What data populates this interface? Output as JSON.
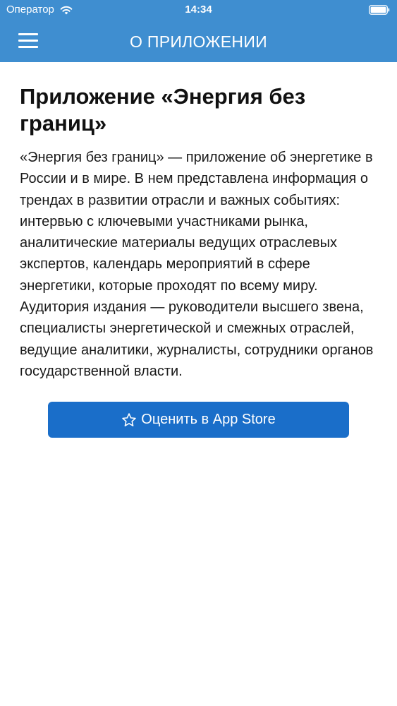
{
  "status_bar": {
    "carrier": "Оператор",
    "time": "14:34"
  },
  "nav": {
    "title": "О ПРИЛОЖЕНИИ"
  },
  "content": {
    "title": "Приложение «Энергия без границ»",
    "description": "«Энергия без границ» — приложение об энергетике в России и в мире. В нем представлена информация о трендах в развитии отрасли и важных событиях: интервью с ключевыми участниками рынка, аналитические материалы ведущих отраслевых экспертов, календарь мероприятий в сфере энергетики, которые проходят по всему миру. Аудитория издания — руководители высшего звена, специалисты энергетической и смежных отраслей, ведущие аналитики, журналисты, сотрудники органов государственной власти.",
    "rate_button_label": "Оценить в App Store"
  },
  "icons": {
    "menu": "hamburger-menu-icon",
    "wifi": "wifi-icon",
    "battery": "battery-icon",
    "star": "star-outline-icon"
  },
  "colors": {
    "header_bg": "#3f8ed0",
    "button_bg": "#1a6ec9",
    "text": "#1a1a1a"
  }
}
